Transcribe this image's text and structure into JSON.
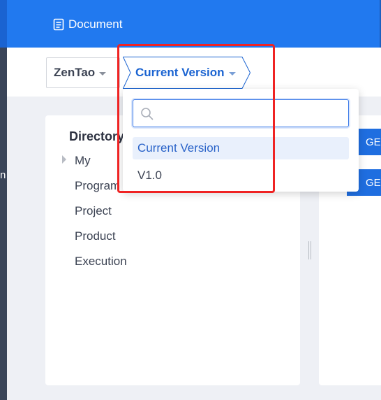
{
  "sidebar": {
    "partial_label": "n"
  },
  "header": {
    "title": "Document",
    "icon": "document-icon"
  },
  "breadcrumb": {
    "product_label": "ZenTao",
    "version_label": "Current Version"
  },
  "version_dropdown": {
    "search_value": "",
    "options": [
      {
        "label": "Current Version",
        "selected": true
      },
      {
        "label": "V1.0",
        "selected": false
      }
    ]
  },
  "directory": {
    "title": "Directory",
    "items": [
      "My",
      "Program",
      "Project",
      "Product",
      "Execution"
    ]
  },
  "actions": {
    "buttons": [
      "GE",
      "GE"
    ]
  },
  "colors": {
    "header_blue": "#2179ef",
    "accent_blue": "#1a63d1",
    "highlight_red": "#ef2323"
  }
}
